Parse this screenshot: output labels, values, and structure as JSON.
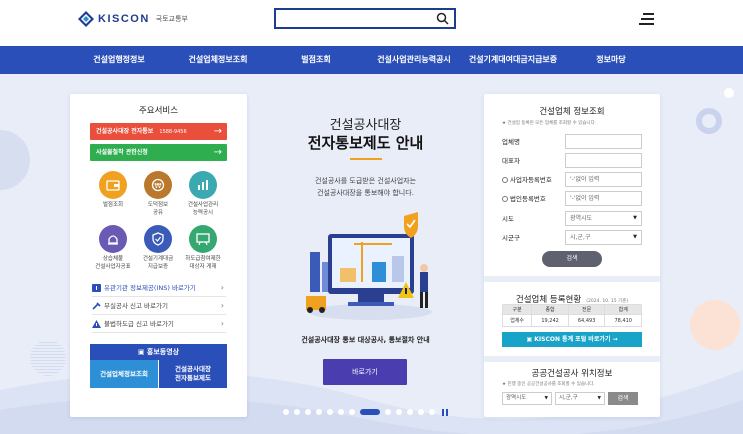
{
  "header": {
    "logo_text": "KISCON",
    "logo_sub": "국토교통부",
    "search_placeholder": ""
  },
  "gnb": [
    "건설업행정정보",
    "건설업체정보조회",
    "벌점조회",
    "건설사업관리능력공시",
    "건설기계대여대금지급보증",
    "정보마당"
  ],
  "left": {
    "title": "주요서비스",
    "bar1": {
      "label": "건설공사대장 전자통보",
      "number": "1588-9456"
    },
    "bar2": {
      "label": "사설물철착 관한신청"
    },
    "services": [
      {
        "label": "벌점조회",
        "icon": "wallet-icon",
        "color": "#f0a11f"
      },
      {
        "label": "도덕점보\n공유",
        "icon": "coin-icon",
        "color": "#b9782c"
      },
      {
        "label": "건설사업관리\n능력공시",
        "icon": "bar-chart-icon",
        "color": "#3aaab0"
      },
      {
        "label": "상습체불\n건설사업자공표",
        "icon": "alarm-icon",
        "color": "#6a5ab4"
      },
      {
        "label": "건설기계대금\n지급보증",
        "icon": "shield-icon",
        "color": "#3a5bb8"
      },
      {
        "label": "하도급참여제한\n대상자 게재",
        "icon": "board-icon",
        "color": "#35a872"
      }
    ],
    "links": [
      "유관기관 정보제공(INS) 바로가기",
      "부실공사 신고 바로가기",
      "불법하도급 신고 바로가기"
    ],
    "promo_title": "홍보동영상",
    "promo_btn1": "건설업체정보조회",
    "promo_btn2": "건설공사대장\n전자통보제도"
  },
  "center": {
    "subtitle": "건설공사대장",
    "title": "전자통보제도 안내",
    "desc": "건설공사를 도급받은 건설사업자는\n건설공사대장을 통보해야 합니다.",
    "caption": "건설공사대장 통보 대상공사, 통보절차 안내",
    "button": "바로가기"
  },
  "right": {
    "title": "건설업체 정보조회",
    "note": "★ 건설업 등록된 모든 업체를 조회할 수 있습니다.",
    "fields": {
      "company": "업체명",
      "ceo": "대표자",
      "reg_no": "사업자등록번호",
      "corp_no": "법인등록번호",
      "reg_no_ph": "'-'없이 입력",
      "corp_no_ph": "'-'없이 입력",
      "sido": "시도",
      "sido_ph": "광역시도",
      "sigungu": "시군구",
      "sigungu_ph": "시,군,구"
    },
    "search_btn": "검색",
    "stats_title": "건설업체 등록현황",
    "stats_date": "(2024. 10. 15 기준)",
    "stats_headers": [
      "구분",
      "종합",
      "전문",
      "합계"
    ],
    "stats_row": [
      "업체수",
      "19,242",
      "64,493",
      "78,410"
    ],
    "stats_btn": "KISCON 통계 포털 바로가기 →",
    "public_title": "공공건설공사 위치정보",
    "public_note": "★ 진행 중인 공공건설공사를 조회할 수 있습니다.",
    "public_sido": "광역시도",
    "public_sigungu": "시,군,구",
    "public_btn": "검색"
  },
  "colors": {
    "brand": "#2a4fb8",
    "bar1": "#e94f3a",
    "bar2": "#2eae4f",
    "cta": "#4a3db0",
    "accent": "#f0a11f"
  }
}
